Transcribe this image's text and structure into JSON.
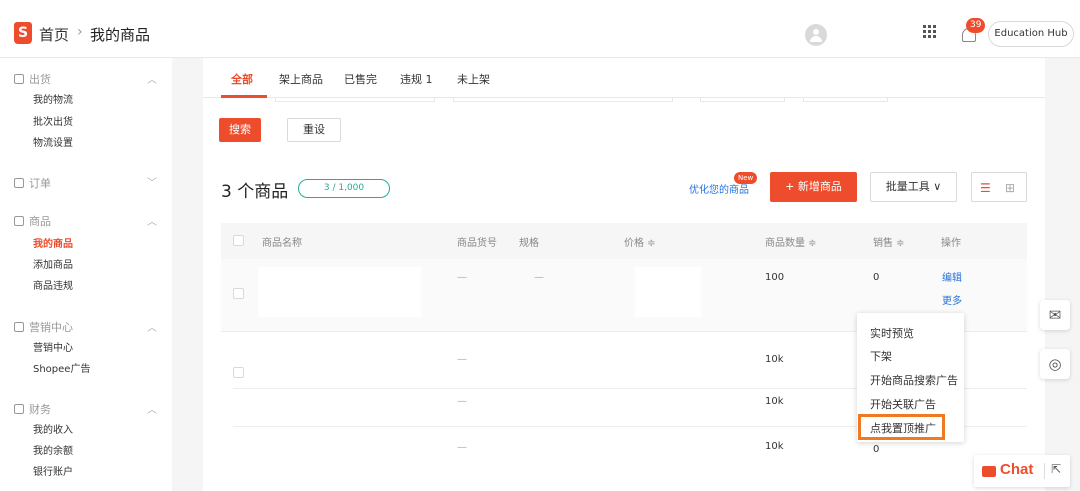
{
  "header": {
    "logo_text": "S",
    "breadcrumb_home": "首页",
    "breadcrumb_sep": "›",
    "breadcrumb_current": "我的商品",
    "notification_count": "39",
    "shop_name": "Education Hub"
  },
  "sidebar": {
    "groups": [
      {
        "label": "出货",
        "items": [
          "我的物流",
          "批次出货",
          "物流设置"
        ]
      },
      {
        "label": "订单",
        "items": []
      },
      {
        "label": "商品",
        "items": [
          "我的商品",
          "添加商品",
          "商品违规"
        ]
      },
      {
        "label": "营销中心",
        "items": [
          "营销中心",
          "Shopee广告"
        ]
      },
      {
        "label": "财务",
        "items": [
          "我的收入",
          "我的余额",
          "银行账户"
        ]
      }
    ],
    "active_item": "我的商品"
  },
  "tabs": [
    "全部",
    "架上商品",
    "已售完",
    "违规 1",
    "未上架"
  ],
  "filters": {
    "search_label": "搜索",
    "reset_label": "重设"
  },
  "summary": {
    "title": "3 个商品",
    "quota": "3 / 1,000",
    "optimize_link": "优化您的商品",
    "new_badge": "New",
    "add_button": "+ 新增商品",
    "bulk_tools": "批量工具 ∨"
  },
  "table": {
    "columns": [
      "商品名称",
      "商品货号",
      "规格",
      "价格 ≑",
      "商品数量 ≑",
      "销售 ≑",
      "操作"
    ],
    "rows": [
      {
        "sku": "—",
        "variation": "—",
        "stock": "100",
        "sales": "0",
        "actions": [
          "编辑",
          "更多"
        ]
      },
      {
        "sku": "—",
        "stock": "10k"
      },
      {
        "sku": "—",
        "stock": "10k"
      },
      {
        "sku": "—",
        "stock": "10k",
        "sales": "0"
      }
    ]
  },
  "more_menu": [
    "实时预览",
    "下架",
    "开始商品搜索广告",
    "开始关联广告",
    "点我置顶推广"
  ],
  "chat": {
    "label": "Chat"
  },
  "colors": {
    "brand": "#ee4d2d",
    "link": "#2673dd",
    "quota": "#26aa99",
    "highlight": "#f07a22"
  }
}
